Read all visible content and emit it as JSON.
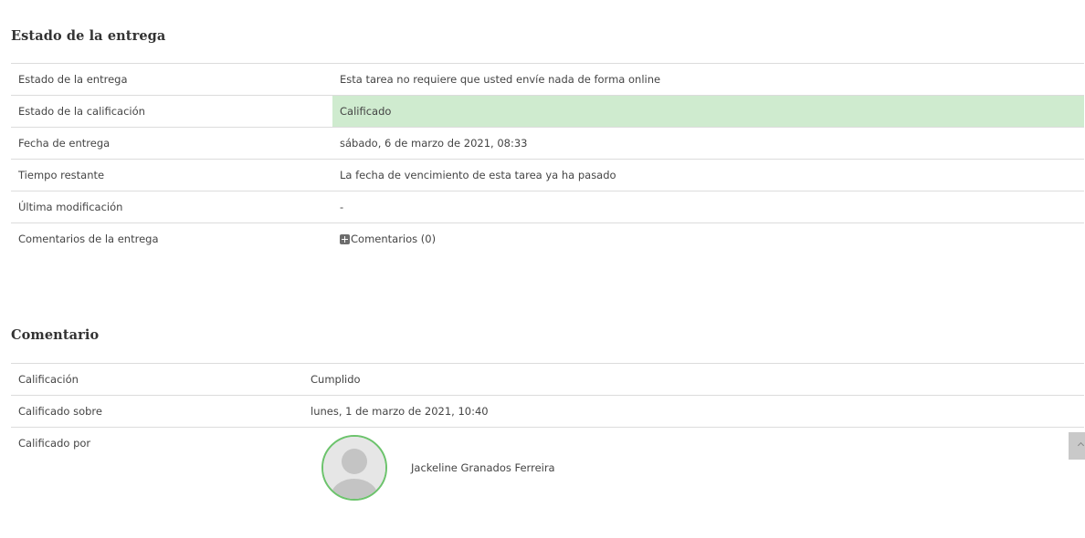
{
  "submission": {
    "title": "Estado de la entrega",
    "rows": [
      {
        "label": "Estado de la entrega",
        "value": "Esta tarea no requiere que usted envíe nada de forma online"
      },
      {
        "label": "Estado de la calificación",
        "value": "Calificado"
      },
      {
        "label": "Fecha de entrega",
        "value": "sábado, 6 de marzo de 2021, 08:33"
      },
      {
        "label": "Tiempo restante",
        "value": "La fecha de vencimiento de esta tarea ya ha pasado"
      },
      {
        "label": "Última modificación",
        "value": "-"
      },
      {
        "label": "Comentarios de la entrega",
        "value": "Comentarios (0)"
      }
    ]
  },
  "feedback": {
    "title": "Comentario",
    "rows": [
      {
        "label": "Calificación",
        "value": "Cumplido"
      },
      {
        "label": "Calificado sobre",
        "value": "lunes, 1 de marzo de 2021, 10:40"
      },
      {
        "label": "Calificado por",
        "value": "Jackeline Granados Ferreira"
      }
    ]
  },
  "colors": {
    "graded_highlight": "#cfebcf",
    "avatar_border": "#6cc36c"
  },
  "icons": {
    "comments": "plus-icon",
    "avatar": "default-user-avatar",
    "back_to_top": "chevron-up-icon"
  }
}
